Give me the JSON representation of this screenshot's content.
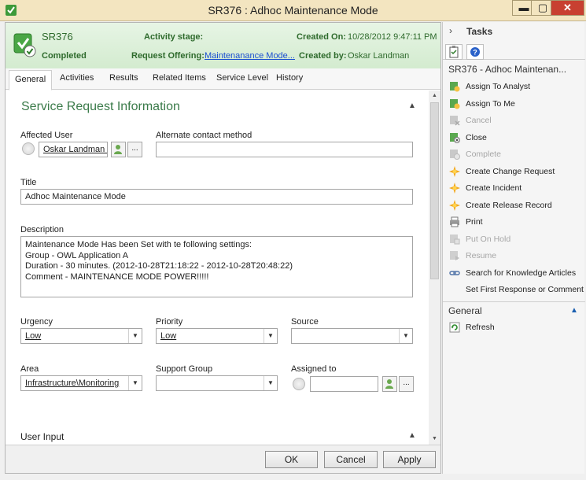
{
  "window": {
    "title": "SR376 : Adhoc Maintenance Mode",
    "min": "▬",
    "max": "▢",
    "close": "✕"
  },
  "header": {
    "sr_id": "SR376",
    "status": "Completed",
    "activity_stage_label": "Activity stage:",
    "request_offering_label": "Request Offering:",
    "request_offering_value": "Maintenanance Mode...",
    "created_on_label": "Created On:",
    "created_on_value": "10/28/2012 9:47:11 PM",
    "created_by_label": "Created by:",
    "created_by_value": "Oskar Landman"
  },
  "tabs": [
    "General",
    "Activities",
    "Results",
    "Related Items",
    "Service Level",
    "History"
  ],
  "form": {
    "section_title": "Service Request Information",
    "affected_user_label": "Affected User",
    "affected_user_value": "Oskar Landman (",
    "alternate_contact_label": "Alternate contact method",
    "alternate_contact_value": "",
    "title_label": "Title",
    "title_value": "Adhoc Maintenance Mode",
    "description_label": "Description",
    "description_lines": [
      "Maintenance Mode Has been Set with te following settings:",
      "Group - OWL Application A",
      "Duration - 30 minutes. (2012-10-28T21:18:22 - 2012-10-28T20:48:22)",
      "Comment - MAINTENANCE MODE POWER!!!!!"
    ],
    "urgency_label": "Urgency",
    "urgency_value": "Low",
    "priority_label": "Priority",
    "priority_value": "Low",
    "source_label": "Source",
    "source_value": "",
    "area_label": "Area",
    "area_value": "Infrastructure\\Monitoring",
    "support_group_label": "Support Group",
    "support_group_value": "",
    "assigned_to_label": "Assigned to",
    "assigned_to_value": "",
    "user_input_title": "User Input",
    "browse_label": "..."
  },
  "footer": {
    "ok": "OK",
    "cancel": "Cancel",
    "apply": "Apply"
  },
  "tasks": {
    "header": "Tasks",
    "context_title": "SR376 - Adhoc Maintenan...",
    "items": [
      {
        "label": "Assign To Analyst",
        "icon": "assign-icon",
        "enabled": true
      },
      {
        "label": "Assign To Me",
        "icon": "assign-icon",
        "enabled": true
      },
      {
        "label": "Cancel",
        "icon": "cancel-icon",
        "enabled": false
      },
      {
        "label": "Close",
        "icon": "close-task-icon",
        "enabled": true
      },
      {
        "label": "Complete",
        "icon": "complete-icon",
        "enabled": false
      },
      {
        "label": "Create Change Request",
        "icon": "starburst-icon",
        "enabled": true
      },
      {
        "label": "Create Incident",
        "icon": "starburst-icon",
        "enabled": true
      },
      {
        "label": "Create Release Record",
        "icon": "starburst-icon",
        "enabled": true
      },
      {
        "label": "Print",
        "icon": "print-icon",
        "enabled": true
      },
      {
        "label": "Put On Hold",
        "icon": "hold-icon",
        "enabled": false
      },
      {
        "label": "Resume",
        "icon": "resume-icon",
        "enabled": false
      },
      {
        "label": "Search for Knowledge Articles",
        "icon": "link-icon",
        "enabled": true
      },
      {
        "label": "Set First Response or Comment",
        "icon": "",
        "enabled": true
      }
    ],
    "general_title": "General",
    "general_items": [
      {
        "label": "Refresh",
        "icon": "refresh-icon",
        "enabled": true
      }
    ]
  },
  "colors": {
    "accent_green": "#2e6a2c",
    "header_band": "#d3ebcf",
    "title_bar": "#f3e5c0",
    "link_blue": "#1a4fd0",
    "close_red": "#c84031"
  }
}
